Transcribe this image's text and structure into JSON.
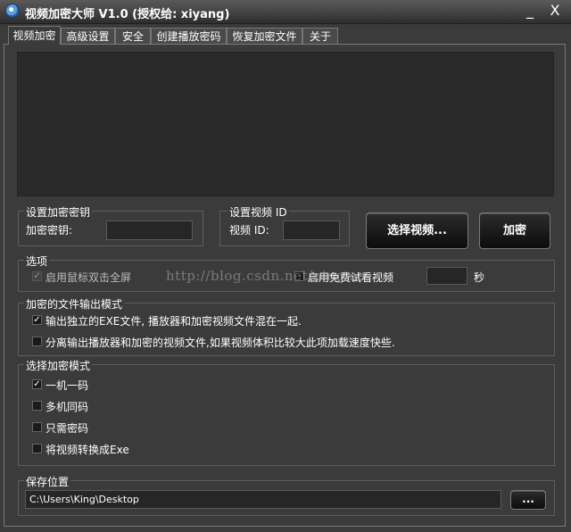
{
  "window": {
    "title": "视频加密大师 V1.0 (授权给: xiyang)",
    "minimize_label": "_",
    "close_label": "X"
  },
  "tabs": [
    {
      "label": "视频加密",
      "active": true
    },
    {
      "label": "高级设置"
    },
    {
      "label": "安全"
    },
    {
      "label": "创建播放密码"
    },
    {
      "label": "恢复加密文件"
    },
    {
      "label": "关于"
    }
  ],
  "key_group": {
    "title": "设置加密密钥",
    "field_label": "加密密钥:",
    "value": ""
  },
  "id_group": {
    "title": "设置视频 ID",
    "field_label": "视频 ID:",
    "value": ""
  },
  "buttons": {
    "select_video": "选择视频...",
    "encrypt": "加密",
    "browse": "..."
  },
  "options": {
    "title": "选项",
    "dblclick_fullscreen": {
      "label": "启用鼠标双击全屏",
      "checked": true,
      "enabled": false
    },
    "free_trial": {
      "label": "启用免费试看视频",
      "checked": false,
      "value": "",
      "unit": "秒"
    }
  },
  "output_mode": {
    "title": "加密的文件输出模式",
    "items": [
      {
        "label": "输出独立的EXE文件, 播放器和加密视频文件混在一起.",
        "checked": true
      },
      {
        "label": "分离输出播放器和加密的视频文件,如果视频体积比较大此项加载速度快些.",
        "checked": false
      }
    ]
  },
  "encrypt_mode": {
    "title": "选择加密模式",
    "items": [
      {
        "label": "一机一码",
        "checked": true
      },
      {
        "label": "多机同码",
        "checked": false
      },
      {
        "label": "只需密码",
        "checked": false
      },
      {
        "label": "将视频转换成Exe",
        "checked": false
      }
    ]
  },
  "save": {
    "title": "保存位置",
    "path": "C:\\Users\\King\\Desktop"
  },
  "watermark": "http://blog.csdn.net/ningme"
}
